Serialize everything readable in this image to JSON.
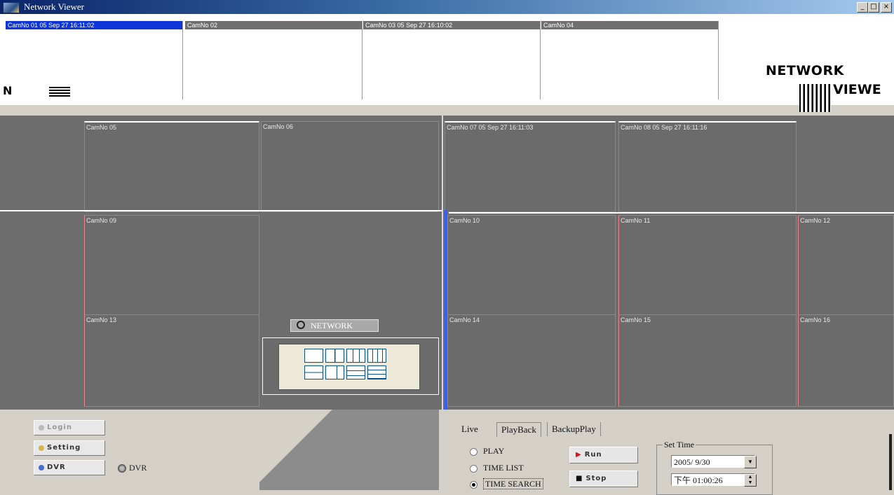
{
  "window": {
    "title": "Network Viewer",
    "controls": {
      "minimize": "_",
      "maximize": "□",
      "close": "×"
    }
  },
  "top_cameras": [
    {
      "label": "CamNo 01 05 Sep 27 16:11:02",
      "selected": true
    },
    {
      "label": "CamNo 02",
      "selected": false
    },
    {
      "label": "CamNo 03 05 Sep 27 16:10:02",
      "selected": false
    },
    {
      "label": "CamNo 04",
      "selected": false
    }
  ],
  "branding": {
    "top_right": "NETWORK",
    "left_fragment": "N",
    "right_fragment": "VIEWE"
  },
  "grid_cameras": [
    {
      "label": "CamNo 05"
    },
    {
      "label": "CamNo 06"
    },
    {
      "label": "CamNo 07 05 Sep 27 16:11:03"
    },
    {
      "label": "CamNo 08 05 Sep 27 16:11:16"
    },
    {
      "label": "CamNo 09"
    },
    {
      "label": "CamNo 10"
    },
    {
      "label": "CamNo 11"
    },
    {
      "label": "CamNo 12"
    },
    {
      "label": "CamNo 13"
    },
    {
      "label": "CamNo 14"
    },
    {
      "label": "CamNo 15"
    },
    {
      "label": "CamNo 16"
    }
  ],
  "network_badge": "NETWORK",
  "sidebar": {
    "login": "Login",
    "setting": "Setting",
    "dvr": "DVR",
    "dvr_label": "DVR"
  },
  "tabs": [
    {
      "label": "Live",
      "active": false
    },
    {
      "label": "PlayBack",
      "active": true
    },
    {
      "label": "BackupPlay",
      "active": false
    }
  ],
  "playback": {
    "options": [
      {
        "label": "PLAY",
        "selected": false
      },
      {
        "label": "TIME LIST",
        "selected": false
      },
      {
        "label": "TIME SEARCH",
        "selected": true
      }
    ],
    "run_label": "Run",
    "stop_label": "Stop",
    "set_time_legend": "Set Time",
    "date_value": "2005/ 9/30",
    "time_value": "下午 01:00:26"
  },
  "colors": {
    "title_bar": "#0a246a",
    "selected_label": "#0d35d8",
    "grid_background": "#6d6d6d",
    "panel": "#d4d0c8",
    "run_icon": "#d11"
  }
}
